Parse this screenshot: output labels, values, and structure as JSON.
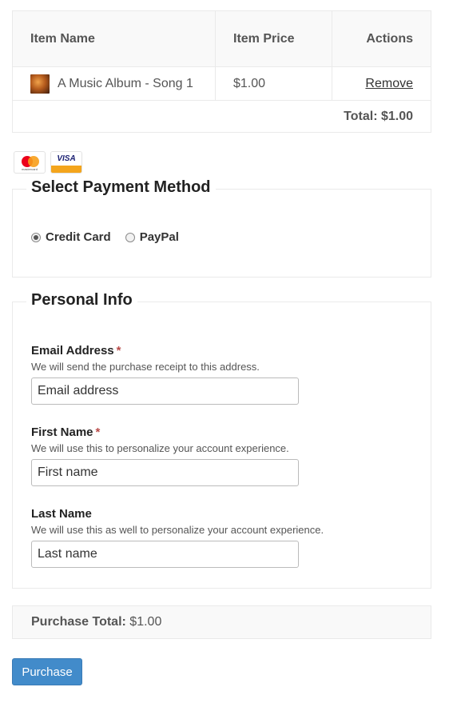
{
  "cart": {
    "headers": {
      "name": "Item Name",
      "price": "Item Price",
      "actions": "Actions"
    },
    "items": [
      {
        "name": "A Music Album - Song 1",
        "price": "$1.00",
        "action": "Remove",
        "thumbnail": "album-cover-thumbnail"
      }
    ],
    "total_label": "Total: $1.00"
  },
  "card_logos": [
    {
      "name": "mastercard-icon",
      "text": "mastercard"
    },
    {
      "name": "visa-icon",
      "text": "VISA"
    }
  ],
  "payment": {
    "legend": "Select Payment Method",
    "options": [
      {
        "label": "Credit Card",
        "checked": true
      },
      {
        "label": "PayPal",
        "checked": false
      }
    ]
  },
  "personal": {
    "legend": "Personal Info",
    "email": {
      "label": "Email Address",
      "required_mark": "*",
      "description": "We will send the purchase receipt to this address.",
      "placeholder": "Email address"
    },
    "first_name": {
      "label": "First Name",
      "required_mark": "*",
      "description": "We will use this to personalize your account experience.",
      "placeholder": "First name"
    },
    "last_name": {
      "label": "Last Name",
      "description": "We will use this as well to personalize your account experience.",
      "placeholder": "Last name"
    }
  },
  "purchase_total": {
    "label": "Purchase Total:",
    "value": "$1.00"
  },
  "purchase_button": "Purchase",
  "colors": {
    "button_blue": "#428bca",
    "required_red": "#b94a48",
    "mastercard_red": "#eb001b",
    "mastercard_orange": "#f79e1b",
    "visa_blue": "#1a1f71",
    "visa_gold": "#f4a51c"
  }
}
